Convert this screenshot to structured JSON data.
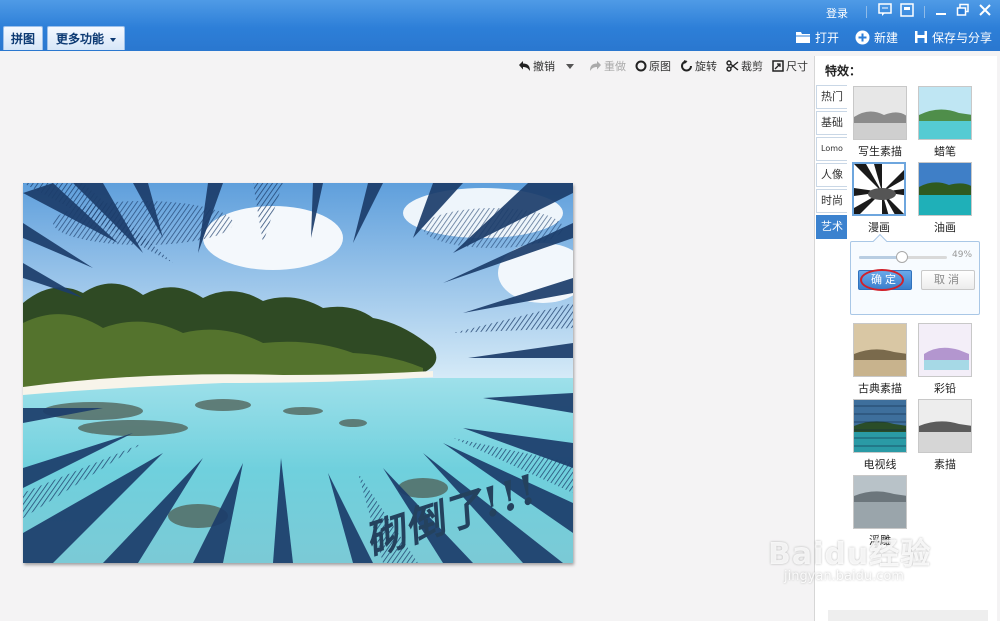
{
  "titlebar": {
    "tabs": [
      "拼图",
      "更多功能"
    ],
    "login": "登录",
    "actions": {
      "open": "打开",
      "new": "新建",
      "save_share": "保存与分享"
    }
  },
  "toolbar": {
    "undo": "撤销",
    "redo": "重做",
    "original": "原图",
    "rotate": "旋转",
    "crop": "裁剪",
    "size": "尺寸"
  },
  "canvas": {
    "image_text": "砌倒了!!!"
  },
  "panel": {
    "title": "特效：",
    "tabs": [
      "热门",
      "基础",
      "Lomo",
      "人像",
      "时尚",
      "艺术"
    ],
    "active_tab": "艺术",
    "effects": [
      "写生素描",
      "蜡笔",
      "漫画",
      "油画",
      "古典素描",
      "彩铅",
      "电视线",
      "素描",
      "浮雕"
    ],
    "selected_effect": "漫画",
    "slider": {
      "value_text": "49%",
      "value": 0.49
    },
    "ok": "确定",
    "cancel": "取消"
  },
  "watermark": {
    "brand": "Baidu经验",
    "url": "jingyan.baidu.com"
  },
  "colors": {
    "titlebar": "#2d7fd8",
    "accent": "#3b82cf",
    "highlight_ring": "#d0202a"
  }
}
